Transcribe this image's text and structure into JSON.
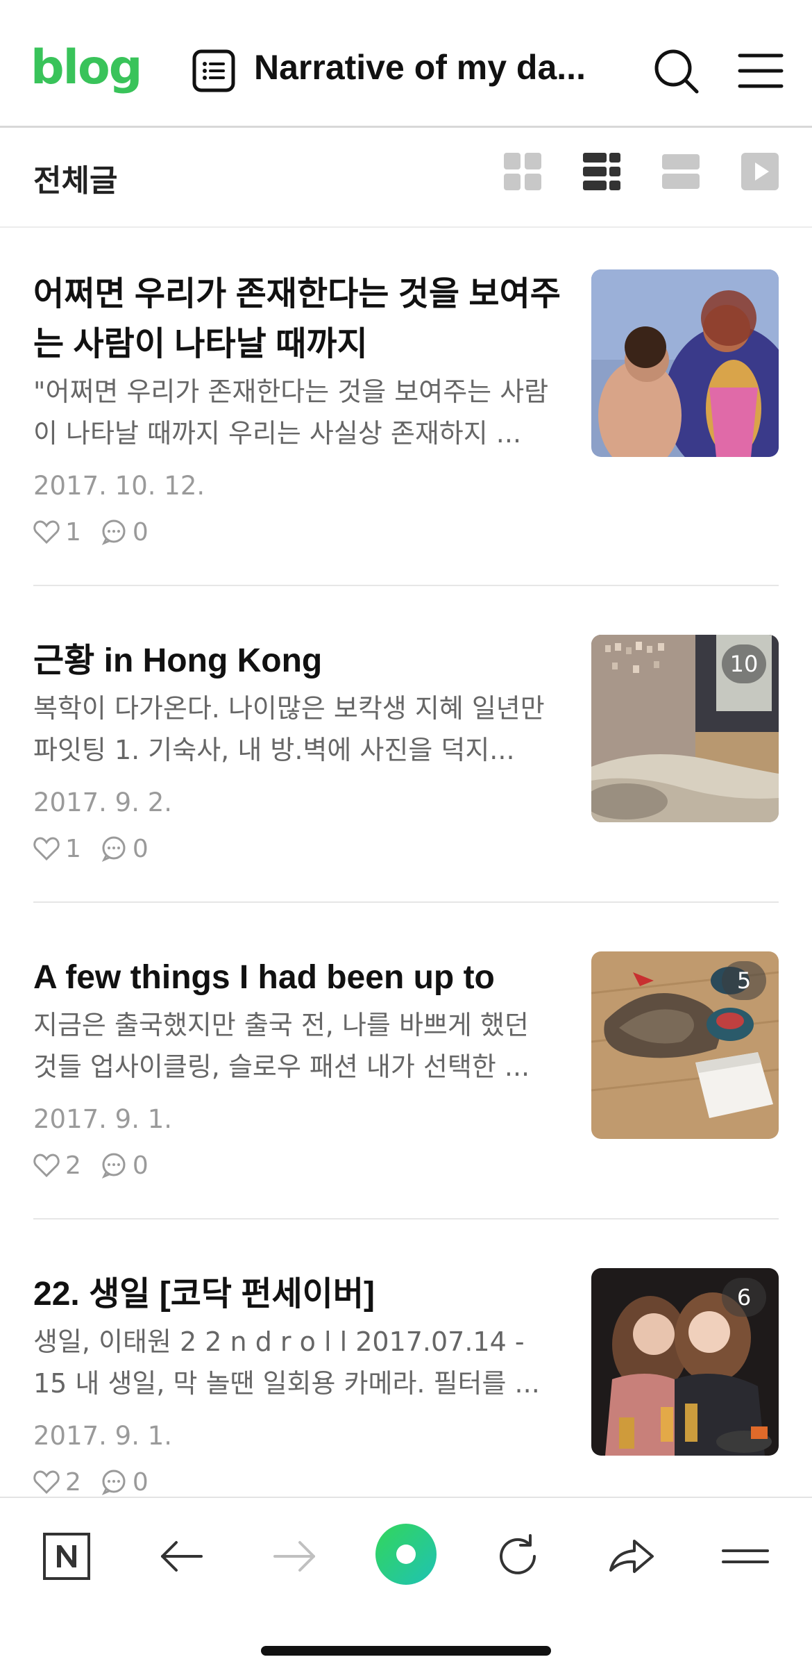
{
  "header": {
    "logo": "blog",
    "blog_title": "Narrative of my da..."
  },
  "category": {
    "label": "전체글"
  },
  "posts": [
    {
      "title": "어쩌면 우리가 존재한다는 것을 보여주는 사람이 나타날 때까지",
      "excerpt": "\"어쩌면 우리가 존재한다는 것을 보여주는 사람이 나타날 때까지 우리는 사실상 존재하지 ...",
      "date": "2017. 10. 12.",
      "likes": "1",
      "comments": "0",
      "image_count": ""
    },
    {
      "title": "근황 in Hong Kong",
      "excerpt": "복학이 다가온다. 나이많은 보칵생 지혜 일년만 파잇팅 1. 기숙사, 내 방.벽에 사진을 덕지...",
      "date": "2017. 9. 2.",
      "likes": "1",
      "comments": "0",
      "image_count": "10"
    },
    {
      "title": "A few things I had been up to",
      "excerpt": "지금은 출국했지만 출국 전, 나를 바쁘게 했던 것들 업사이클링, 슬로우 패션 내가 선택한 ...",
      "date": "2017. 9. 1.",
      "likes": "2",
      "comments": "0",
      "image_count": "5"
    },
    {
      "title": "22. 생일 [코닥 펀세이버]",
      "excerpt": "생일, 이태원 2 2 n d r o l l 2017.07.14 - 15 내 생일, 막 놀땐 일회용 카메라. 필터를 ...",
      "date": "2017. 9. 1.",
      "likes": "2",
      "comments": "0",
      "image_count": "6"
    }
  ],
  "colors": {
    "brand": "#39c35a",
    "text": "#111111",
    "muted": "#9a9a9a"
  },
  "icons": {
    "header": [
      "list-icon",
      "search-icon",
      "menu-icon"
    ],
    "views": [
      "grid-view-icon",
      "list-view-icon",
      "card-view-icon",
      "video-view-icon"
    ],
    "toolbar": [
      "naver-icon",
      "back-arrow-icon",
      "forward-arrow-icon",
      "green-dot-icon",
      "refresh-icon",
      "share-icon",
      "more-menu-icon"
    ]
  }
}
